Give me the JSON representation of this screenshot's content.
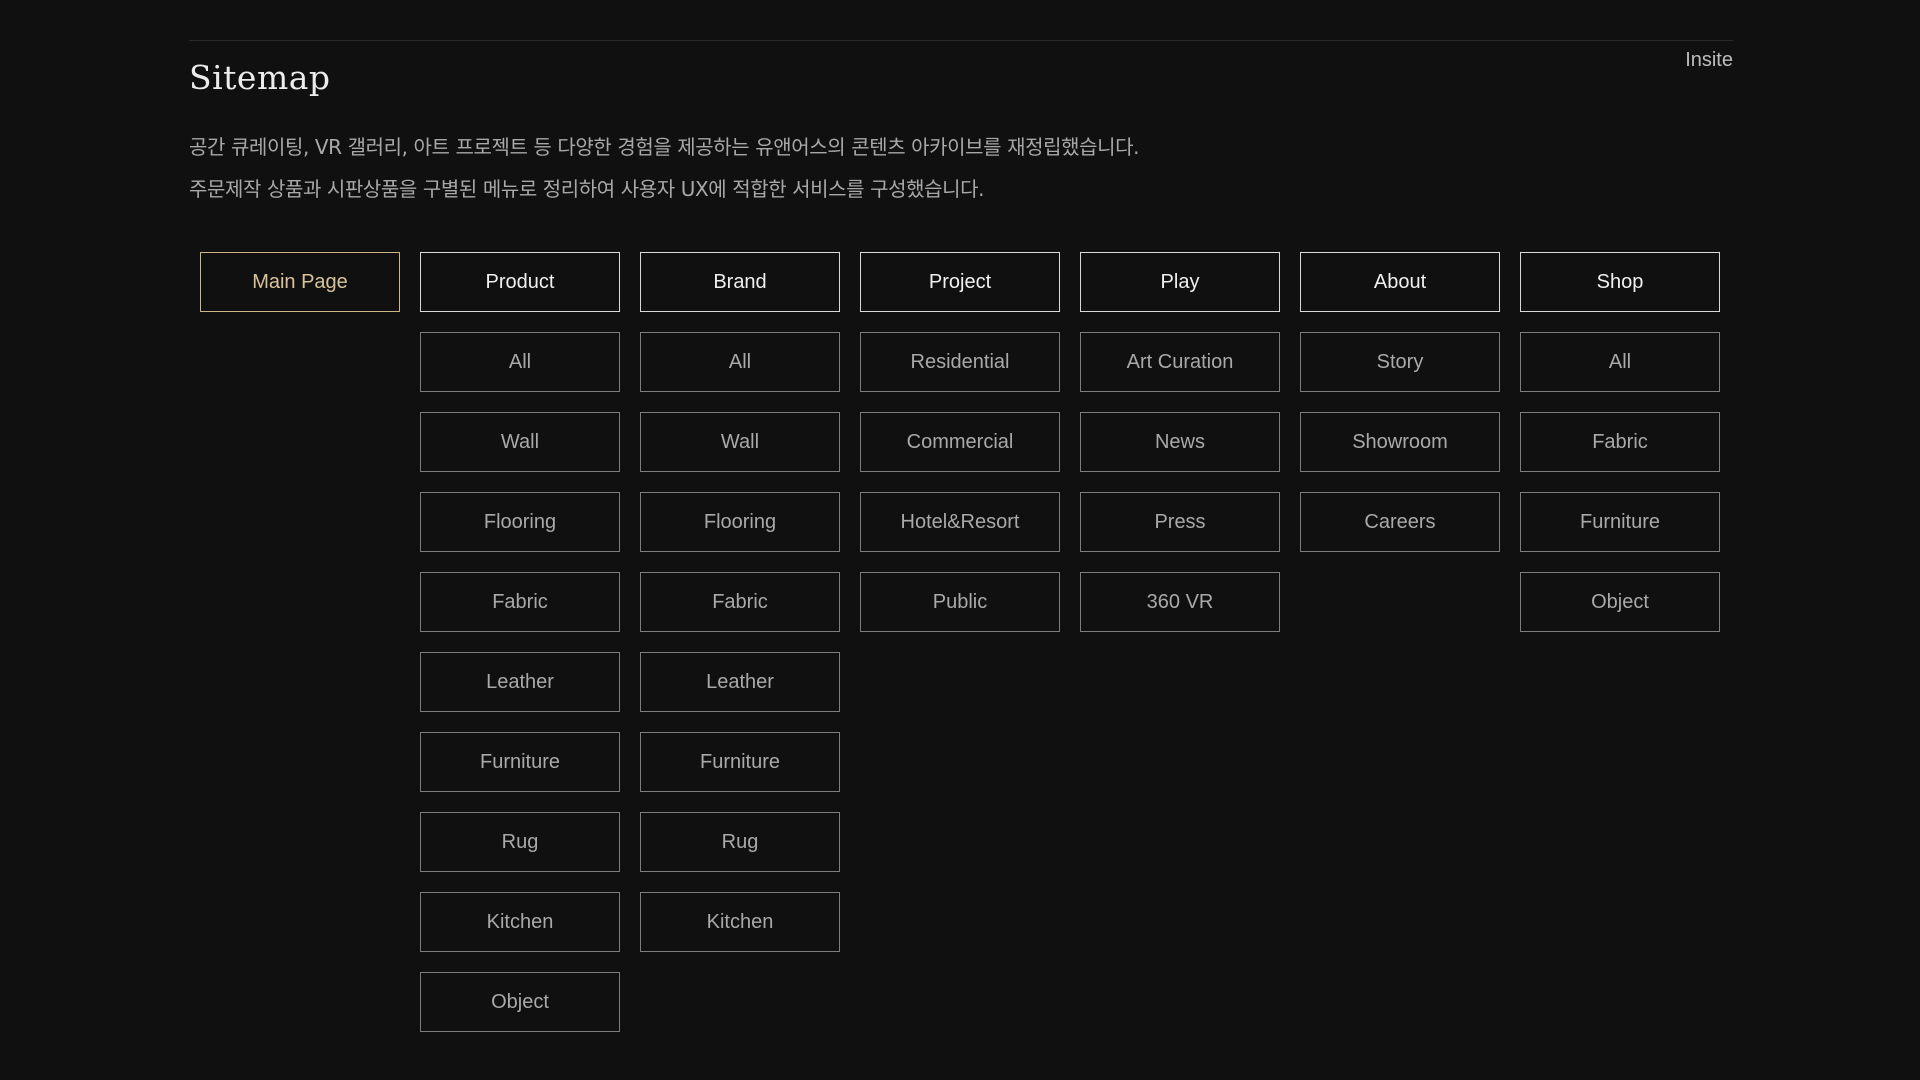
{
  "header": {
    "title": "Sitemap",
    "section_label": "Insite"
  },
  "description": {
    "line1": "공간 큐레이팅, VR 갤러리, 아트 프로젝트 등 다양한 경험을 제공하는 유앤어스의 콘텐츠 아카이브를 재정립했습니다.",
    "line2": "주문제작 상품과 시판상품을 구별된 메뉴로 정리하여 사용자 UX에 적합한 서비스를 구성했습니다."
  },
  "colors": {
    "background": "#101010",
    "accent_gold": "#cdb58a",
    "header_border": "#d9d9d9",
    "item_border": "#7c7c7c"
  },
  "sitemap": {
    "main": {
      "label": "Main Page"
    },
    "columns": [
      {
        "label": "Product",
        "items": [
          "All",
          "Wall",
          "Flooring",
          "Fabric",
          "Leather",
          "Furniture",
          "Rug",
          "Kitchen",
          "Object"
        ]
      },
      {
        "label": "Brand",
        "items": [
          "All",
          "Wall",
          "Flooring",
          "Fabric",
          "Leather",
          "Furniture",
          "Rug",
          "Kitchen"
        ]
      },
      {
        "label": "Project",
        "items": [
          "Residential",
          "Commercial",
          "Hotel&Resort",
          "Public"
        ]
      },
      {
        "label": "Play",
        "items": [
          "Art Curation",
          "News",
          "Press",
          "360 VR"
        ]
      },
      {
        "label": "About",
        "items": [
          "Story",
          "Showroom",
          "Careers"
        ]
      },
      {
        "label": "Shop",
        "items": [
          "All",
          "Fabric",
          "Furniture",
          "Object"
        ]
      }
    ]
  }
}
